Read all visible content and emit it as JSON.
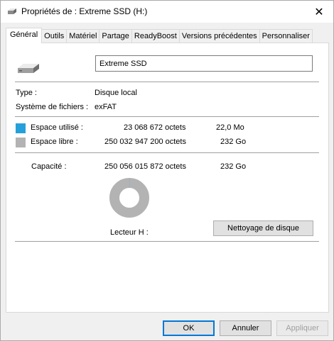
{
  "window": {
    "title": "Propriétés de : Extreme SSD (H:)",
    "close_glyph": "✕"
  },
  "tabs": [
    {
      "label": "Général",
      "active": true
    },
    {
      "label": "Outils"
    },
    {
      "label": "Matériel"
    },
    {
      "label": "Partage"
    },
    {
      "label": "ReadyBoost"
    },
    {
      "label": "Versions précédentes"
    },
    {
      "label": "Personnaliser"
    }
  ],
  "general": {
    "drive_name": "Extreme SSD",
    "type_label": "Type :",
    "type_value": "Disque local",
    "fs_label": "Système de fichiers :",
    "fs_value": "exFAT",
    "used_label": "Espace utilisé :",
    "used_bytes": "23 068 672 octets",
    "used_size": "22,0 Mo",
    "free_label": "Espace libre :",
    "free_bytes": "250 032 947 200 octets",
    "free_size": "232 Go",
    "capacity_label": "Capacité :",
    "capacity_bytes": "250 056 015 872 octets",
    "capacity_size": "232 Go",
    "drive_letter_label": "Lecteur H :",
    "cleanup_button": "Nettoyage de disque",
    "used_fraction": 9.22e-05
  },
  "colors": {
    "used": "#26a0da",
    "free": "#b3b3b3",
    "accent": "#0078d7"
  },
  "buttons": {
    "ok": "OK",
    "cancel": "Annuler",
    "apply": "Appliquer"
  }
}
